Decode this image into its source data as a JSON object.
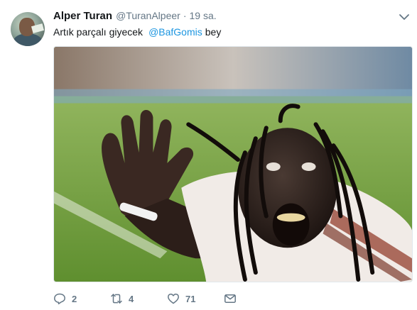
{
  "tweet": {
    "author_name": "Alper Turan",
    "handle": "@TuranAlpeer",
    "separator": "·",
    "time": "19 sa.",
    "text_before": "Artık parçalı giyecek",
    "mention": "@BafGomis",
    "text_after": "bey"
  },
  "actions": {
    "replies": "2",
    "retweets": "4",
    "likes": "71"
  },
  "colors": {
    "link": "#1b95e0",
    "muted": "#657786",
    "text": "#14171a"
  },
  "icons": [
    "chevron-down-icon",
    "reply-icon",
    "retweet-icon",
    "like-icon",
    "direct-message-icon"
  ]
}
